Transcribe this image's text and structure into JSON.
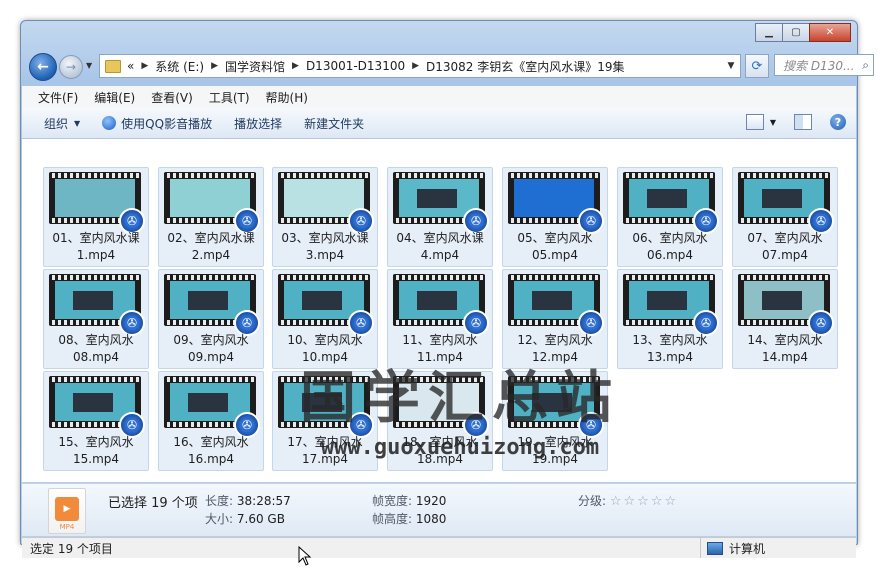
{
  "window": {
    "caption_buttons": [
      "minimize",
      "maximize",
      "close"
    ]
  },
  "address_bar": {
    "overflow": "«",
    "crumbs": [
      "系统 (E:)",
      "国学资料馆",
      "D13001-D13100",
      "D13082 李钥玄《室内风水课》19集"
    ]
  },
  "search": {
    "placeholder": "搜索 D130..."
  },
  "menu": [
    "文件(F)",
    "编辑(E)",
    "查看(V)",
    "工具(T)",
    "帮助(H)"
  ],
  "toolbar": {
    "organize": "组织",
    "play_qq": "使用QQ影音播放",
    "play_select": "播放选择",
    "new_folder": "新建文件夹"
  },
  "files": [
    {
      "line1": "01、室内风水课",
      "line2": "1.mp4",
      "screen": "#6fb6c4",
      "panel": false
    },
    {
      "line1": "02、室内风水课",
      "line2": "2.mp4",
      "screen": "#8fd0d4",
      "panel": false
    },
    {
      "line1": "03、室内风水课",
      "line2": "3.mp4",
      "screen": "#b9e0e2",
      "panel": false
    },
    {
      "line1": "04、室内风水课",
      "line2": "4.mp4",
      "screen": "#5bb8c8",
      "panel": true
    },
    {
      "line1": "05、室内风水",
      "line2": "05.mp4",
      "screen": "#1f6ed1",
      "panel": false
    },
    {
      "line1": "06、室内风水",
      "line2": "06.mp4",
      "screen": "#4fb1c3",
      "panel": true
    },
    {
      "line1": "07、室内风水",
      "line2": "07.mp4",
      "screen": "#4fb1c3",
      "panel": true
    },
    {
      "line1": "08、室内风水",
      "line2": "08.mp4",
      "screen": "#4fb1c3",
      "panel": true
    },
    {
      "line1": "09、室内风水",
      "line2": "09.mp4",
      "screen": "#4fb1c3",
      "panel": true
    },
    {
      "line1": "10、室内风水",
      "line2": "10.mp4",
      "screen": "#4fb1c3",
      "panel": true
    },
    {
      "line1": "11、室内风水",
      "line2": "11.mp4",
      "screen": "#4fb1c3",
      "panel": true
    },
    {
      "line1": "12、室内风水",
      "line2": "12.mp4",
      "screen": "#4fb1c3",
      "panel": true
    },
    {
      "line1": "13、室内风水",
      "line2": "13.mp4",
      "screen": "#4fb1c3",
      "panel": true
    },
    {
      "line1": "14、室内风水",
      "line2": "14.mp4",
      "screen": "#8fbfc6",
      "panel": true
    },
    {
      "line1": "15、室内风水",
      "line2": "15.mp4",
      "screen": "#4fb1c3",
      "panel": true
    },
    {
      "line1": "16、室内风水",
      "line2": "16.mp4",
      "screen": "#4fb1c3",
      "panel": true
    },
    {
      "line1": "17、室内风水",
      "line2": "17.mp4",
      "screen": "#4fb1c3",
      "panel": true
    },
    {
      "line1": "18、室内风水",
      "line2": "18.mp4",
      "screen": "#d9e7ee",
      "panel": false
    },
    {
      "line1": "19、室内风水",
      "line2": "19.mp4",
      "screen": "#4fb1c3",
      "panel": true
    }
  ],
  "watermark": {
    "title": "国学汇总站",
    "url": "www.guoxuehuizong.com"
  },
  "details": {
    "selected": "已选择 19 个项",
    "length_label": "长度:",
    "length_value": "38:28:57",
    "size_label": "大小:",
    "size_value": "7.60 GB",
    "width_label": "帧宽度:",
    "width_value": "1920",
    "height_label": "帧高度:",
    "height_value": "1080",
    "rating_label": "分级:",
    "rating_stars": "☆☆☆☆☆",
    "icon_ext": "MP4"
  },
  "status": {
    "left": "选定 19 个项目",
    "right": "计算机"
  },
  "colors": {
    "accent": "#1e5fb3",
    "selection": "#e6eef8"
  }
}
